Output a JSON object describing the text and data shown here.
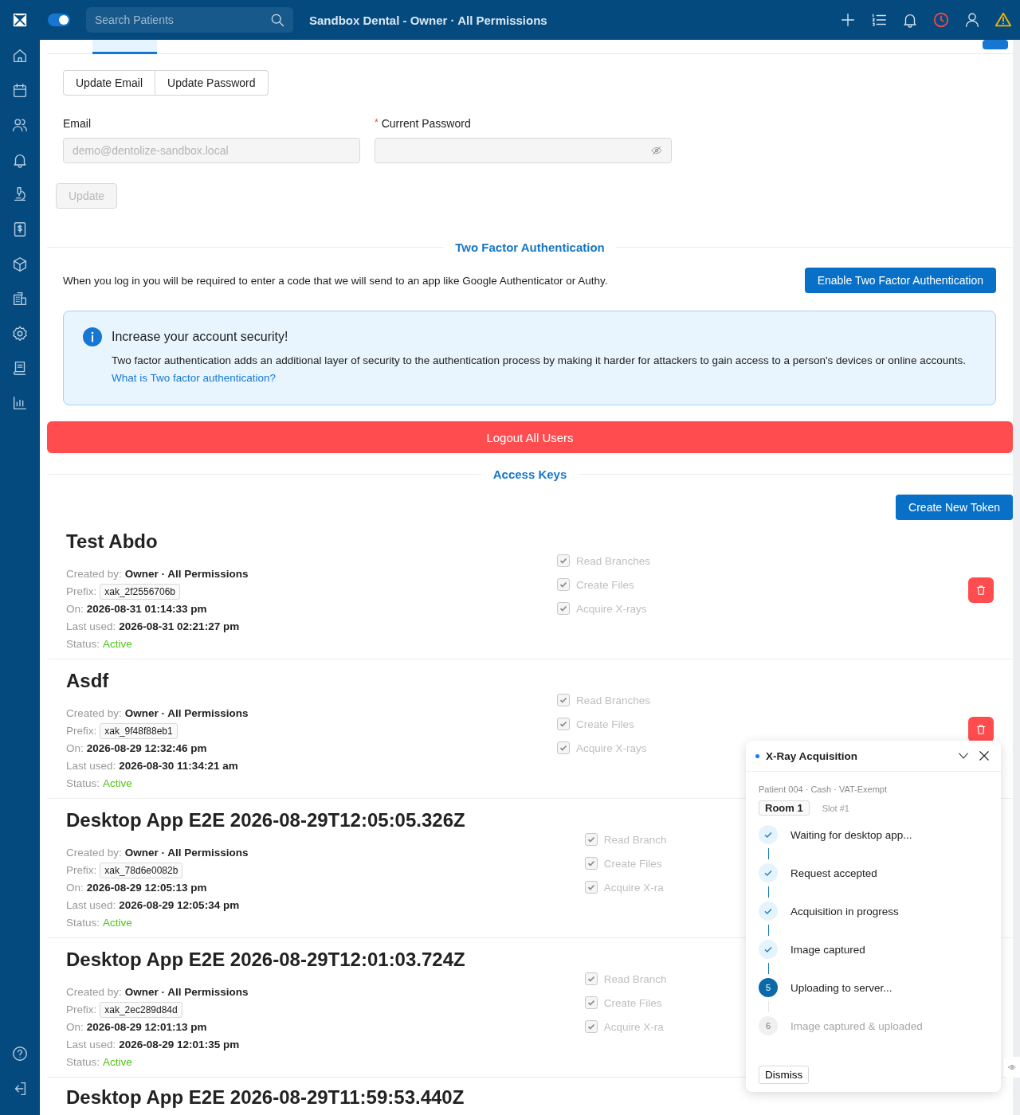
{
  "header": {
    "search": {
      "placeholder": "Search Patients"
    },
    "toggle": {
      "on": true
    },
    "title": "Sandbox Dental - Owner · All Permissions"
  },
  "account": {
    "segments": [
      {
        "label": "Update Email",
        "selected": false
      },
      {
        "label": "Update Password",
        "selected": false
      }
    ],
    "email": {
      "label": "Email",
      "value": "demo@dentolize-sandbox.local",
      "disabled": true
    },
    "password": {
      "label": "Current Password",
      "required": true,
      "required_mark": "*"
    },
    "update_button": {
      "label": "Update",
      "disabled": true
    }
  },
  "two_factor": {
    "heading": "Two Factor Authentication",
    "description": "When you log in you will be required to enter a code that we will send to an app like Google Authenticator or Authy.",
    "button": "Enable Two Factor Authentication",
    "info": {
      "title": "Increase your account security!",
      "body": "Two factor authentication adds an additional layer of security to the authentication process by making it harder for attackers to gain access to a person's devices or online accounts.",
      "link": "What is Two factor authentication?"
    }
  },
  "logout_button": "Logout All Users",
  "access_keys": {
    "heading": "Access Keys",
    "create_button": "Create New Token",
    "keys": [
      {
        "name": "Test Abdo",
        "created_by_label": "Created by:",
        "created_by": "Owner · All Permissions",
        "prefix_label": "Prefix:",
        "prefix": "xak_2f2556706b",
        "on_label": "On:",
        "on": "2026-08-31 01:14:33 pm",
        "last_used_label": "Last used:",
        "last_used": "2026-08-31 02:21:27 pm",
        "status_label": "Status:",
        "status": "Active",
        "permissions": [
          {
            "label": "Read Branches",
            "checked": true
          },
          {
            "label": "Create Files",
            "checked": true
          },
          {
            "label": "Acquire X-rays",
            "checked": true
          }
        ]
      },
      {
        "name": "Asdf",
        "created_by_label": "Created by:",
        "created_by": "Owner · All Permissions",
        "prefix_label": "Prefix:",
        "prefix": "xak_9f48f88eb1",
        "on_label": "On:",
        "on": "2026-08-29 12:32:46 pm",
        "last_used_label": "Last used:",
        "last_used": "2026-08-30 11:34:21 am",
        "status_label": "Status:",
        "status": "Active",
        "permissions": [
          {
            "label": "Read Branches",
            "checked": true
          },
          {
            "label": "Create Files",
            "checked": true
          },
          {
            "label": "Acquire X-rays",
            "checked": true
          }
        ]
      },
      {
        "name": "Desktop App E2E 2026-08-29T12:05:05.326Z",
        "created_by_label": "Created by:",
        "created_by": "Owner · All Permissions",
        "prefix_label": "Prefix:",
        "prefix": "xak_78d6e0082b",
        "on_label": "On:",
        "on": "2026-08-29 12:05:13 pm",
        "last_used_label": "Last used:",
        "last_used": "2026-08-29 12:05:34 pm",
        "status_label": "Status:",
        "status": "Active",
        "permissions": [
          {
            "label": "Read Branch",
            "checked": true
          },
          {
            "label": "Create Files",
            "checked": true
          },
          {
            "label": "Acquire X-ra",
            "checked": true
          }
        ]
      },
      {
        "name": "Desktop App E2E 2026-08-29T12:01:03.724Z",
        "created_by_label": "Created by:",
        "created_by": "Owner · All Permissions",
        "prefix_label": "Prefix:",
        "prefix": "xak_2ec289d84d",
        "on_label": "On:",
        "on": "2026-08-29 12:01:13 pm",
        "last_used_label": "Last used:",
        "last_used": "2026-08-29 12:01:35 pm",
        "status_label": "Status:",
        "status": "Active",
        "permissions": [
          {
            "label": "Read Branch",
            "checked": true
          },
          {
            "label": "Create Files",
            "checked": true
          },
          {
            "label": "Acquire X-ra",
            "checked": true
          }
        ]
      },
      {
        "name": "Desktop App E2E 2026-08-29T11:59:53.440Z"
      }
    ]
  },
  "xray_panel": {
    "title": "X-Ray Acquisition",
    "meta": "Patient 004 · Cash · VAT-Exempt",
    "room": "Room 1",
    "slot": "Slot #1",
    "steps": [
      {
        "label": "Waiting for desktop app...",
        "done": true,
        "current": false
      },
      {
        "label": "Request accepted",
        "done": true,
        "current": false
      },
      {
        "label": "Acquisition in progress",
        "done": true,
        "current": false
      },
      {
        "label": "Image captured",
        "done": true,
        "current": false
      },
      {
        "number": "5",
        "label": "Uploading to server...",
        "done": false,
        "current": true
      },
      {
        "number": "6",
        "label": "Image captured & uploaded",
        "done": false,
        "current": false
      }
    ],
    "dismiss": "Dismiss"
  }
}
